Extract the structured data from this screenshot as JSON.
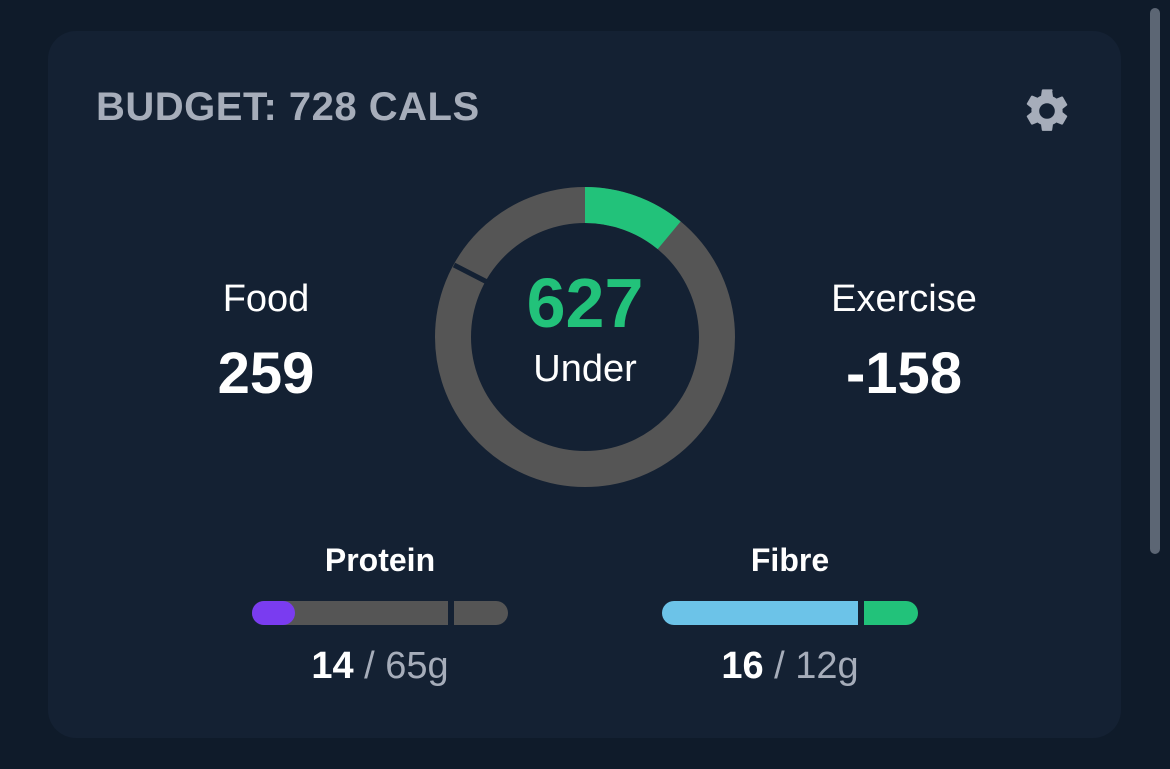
{
  "budget": {
    "title": "BUDGET: 728 CALS"
  },
  "summary": {
    "food_label": "Food",
    "food_value": "259",
    "exercise_label": "Exercise",
    "exercise_value": "-158",
    "remaining_value": "627",
    "remaining_label": "Under",
    "ring_progress_fraction": 0.11
  },
  "macros": [
    {
      "name": "Protein",
      "current": "14",
      "separator": " / ",
      "target": "65g",
      "progress_fraction": 0.22,
      "color": "#7a3cf0"
    },
    {
      "name": "Fibre",
      "current": "16",
      "separator": " / ",
      "target": "12g",
      "progress_fraction": 1.0,
      "color": "#6cc3e8",
      "overflow_color": "#22c27a"
    }
  ],
  "colors": {
    "background": "#0f1b2a",
    "card": "#142133",
    "track": "#555555",
    "accent_green": "#22c27a",
    "title_gray": "#a6adba"
  },
  "icons": {
    "settings": "gear-icon"
  }
}
